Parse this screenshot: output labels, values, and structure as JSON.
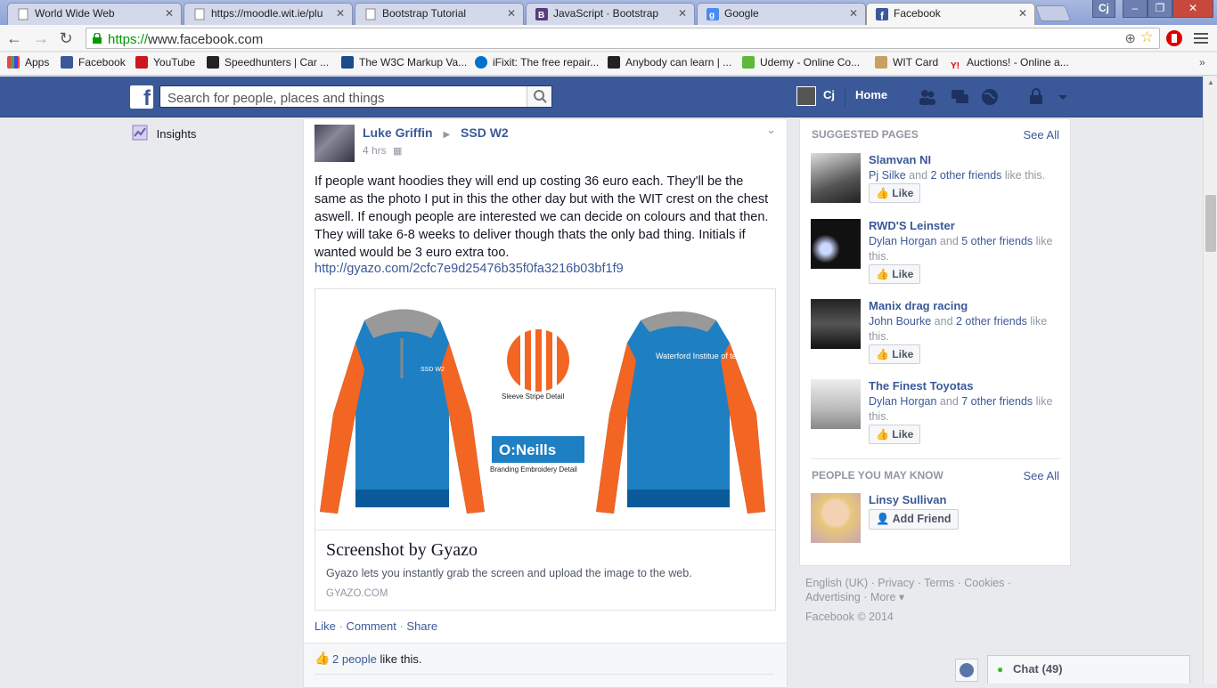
{
  "tabs": [
    {
      "label": "World Wide Web",
      "active": false
    },
    {
      "label": "https://moodle.wit.ie/plu",
      "active": false
    },
    {
      "label": "Bootstrap Tutorial",
      "active": false
    },
    {
      "label": "JavaScript · Bootstrap",
      "active": false
    },
    {
      "label": "Google",
      "active": false
    },
    {
      "label": "Facebook",
      "active": true
    }
  ],
  "window": {
    "user": "Cj",
    "minimize": "–",
    "maximize": "❐",
    "close": "✕"
  },
  "address": {
    "scheme": "https://",
    "host": "www.facebook.com"
  },
  "bookmarks": [
    {
      "label": "Apps"
    },
    {
      "label": "Facebook"
    },
    {
      "label": "YouTube"
    },
    {
      "label": "Speedhunters | Car ..."
    },
    {
      "label": "The W3C Markup Va..."
    },
    {
      "label": "iFixit: The free repair..."
    },
    {
      "label": "Anybody can learn | ..."
    },
    {
      "label": "Udemy - Online Co..."
    },
    {
      "label": "WIT Card"
    },
    {
      "label": "Auctions! - Online a..."
    }
  ],
  "fb": {
    "search_placeholder": "Search for people, places and things",
    "user": "Cj",
    "home": "Home"
  },
  "left": {
    "insights": "Insights"
  },
  "post": {
    "author": "Luke Griffin",
    "group": "SSD W2",
    "time": "4 hrs",
    "text": "If people want hoodies they will end up costing 36 euro each. They'll be the same as the photo I put in this the other day but with the WIT crest on the chest aswell. If enough people are interested we can decide on colours and that then. They will take 6-8 weeks to deliver though thats the only bad thing. Initials if wanted would be 3 euro extra too.",
    "link": "http://gyazo.com/2cfc7e9d25476b35f0fa3216b03bf1f9",
    "image_text": {
      "front": "SSD W2",
      "stripe": "Sleeve Stripe Detail",
      "brand": "O:Neills",
      "brand_caption": "Branding Embroidery Detail",
      "back": "Waterford Institue of technology"
    },
    "card_title": "Screenshot by Gyazo",
    "card_desc": "Gyazo lets you instantly grab the screen and upload the image to the web.",
    "card_domain": "GYAZO.COM",
    "actions": {
      "like": "Like",
      "comment": "Comment",
      "share": "Share",
      "sep": "·"
    },
    "likes_count": "2 people",
    "likes_suffix": "like this."
  },
  "suggested": {
    "heading": "SUGGESTED PAGES",
    "see_all": "See All",
    "like_label": "Like",
    "pages": [
      {
        "name": "Slamvan NI",
        "friend": "Pj Silke",
        "and": " and ",
        "others": "2 other friends",
        "tail": " like this."
      },
      {
        "name": "RWD'S Leinster",
        "friend": "Dylan Horgan",
        "and": " and ",
        "others": "5 other friends",
        "tail": " like this."
      },
      {
        "name": "Manix drag racing",
        "friend": "John Bourke",
        "and": " and ",
        "others": "2 other friends",
        "tail": " like this."
      },
      {
        "name": "The Finest Toyotas",
        "friend": "Dylan Horgan",
        "and": " and ",
        "others": "7 other friends",
        "tail": " like this."
      }
    ]
  },
  "people": {
    "heading": "PEOPLE YOU MAY KNOW",
    "see_all": "See All",
    "name": "Linsy Sullivan",
    "add_friend": "Add Friend"
  },
  "footer": {
    "line1": "English (UK) · Privacy · Terms · Cookies ·",
    "line2": "Advertising · More ▾",
    "copyright": "Facebook © 2014"
  },
  "chat": {
    "label": "Chat (49)"
  },
  "colors": {
    "fb_blue": "#3b5998",
    "link": "#3b5998",
    "hoodie_blue": "#1e7fc3",
    "hoodie_orange": "#f26522"
  }
}
